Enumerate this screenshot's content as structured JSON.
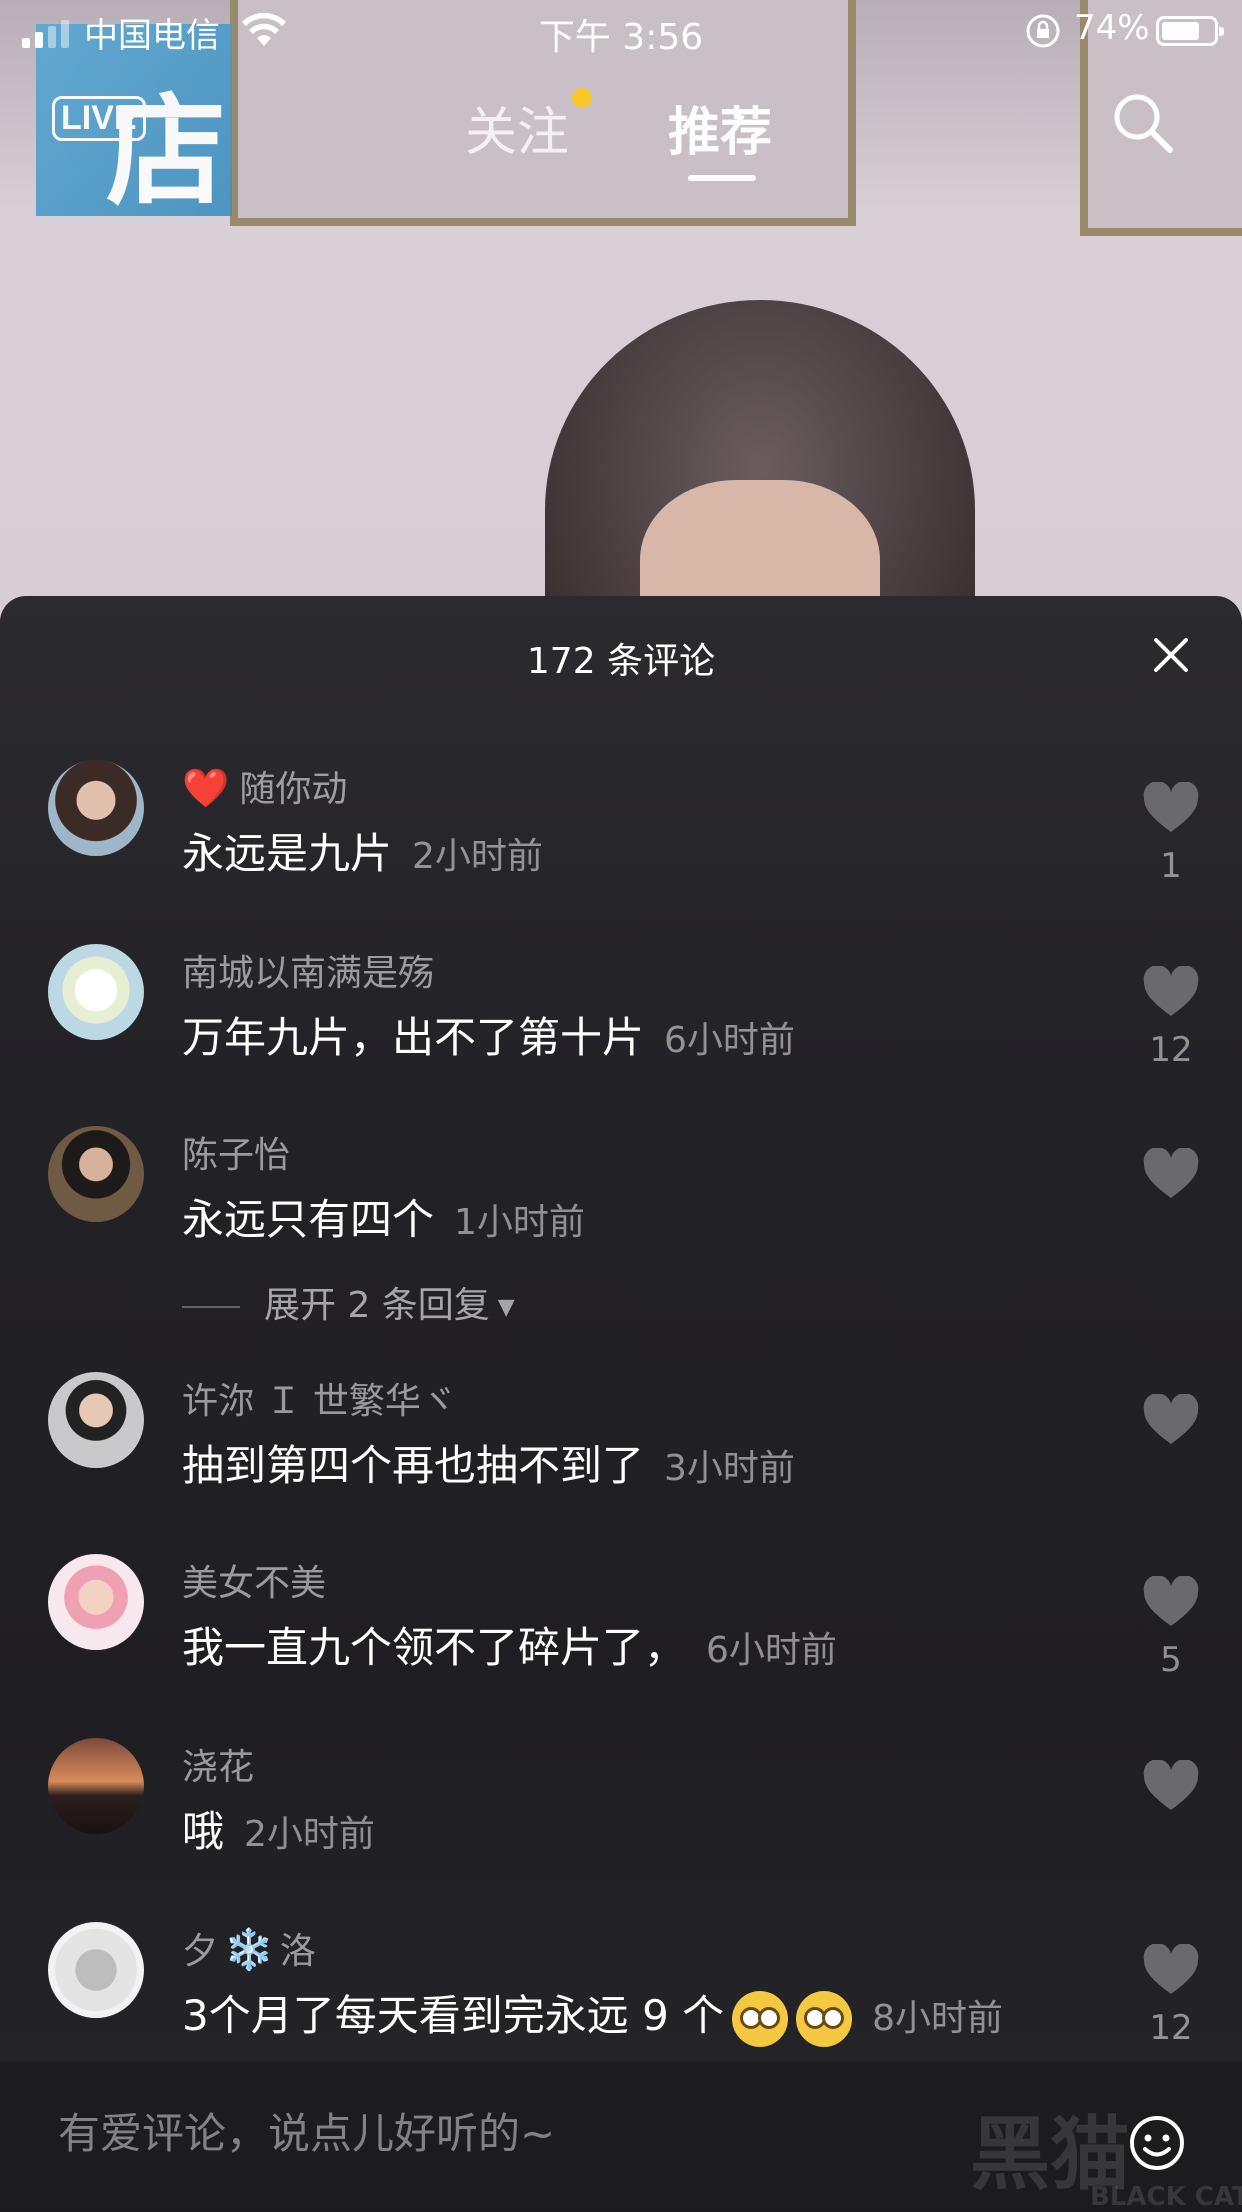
{
  "status_bar": {
    "carrier": "中国电信",
    "time": "下午 3:56",
    "battery_pct": "74%",
    "battery_level": 0.74
  },
  "live_badge": {
    "label": "LIVE",
    "char": "店"
  },
  "nav": {
    "tabs": [
      {
        "label": "关注",
        "has_dot": true
      },
      {
        "label": "推荐",
        "active": true
      }
    ],
    "dot_color": "#f7c72a"
  },
  "comments_sheet": {
    "title": "172 条评论",
    "comments": [
      {
        "username": "随你动",
        "prefix_emoji": "❤️",
        "text": "永远是九片",
        "time": "2小时前",
        "likes": "1"
      },
      {
        "username": "南城以南满是殇",
        "text": "万年九片，出不了第十片",
        "time": "6小时前",
        "likes": "12"
      },
      {
        "username": "陈子怡",
        "text": "永远只有四个",
        "time": "1小时前",
        "likes": ""
      },
      {
        "username": "许沵 Ｉ 世繁华ヾ",
        "text": "抽到第四个再也抽不到了",
        "time": "3小时前",
        "likes": ""
      },
      {
        "username": "美女不美",
        "text": "我一直九个领不了碎片了，",
        "time": "6小时前",
        "likes": "5"
      },
      {
        "username": "浇花",
        "text": "哦",
        "time": "2小时前",
        "likes": ""
      },
      {
        "username_a": "夕",
        "username_snow": "❄️",
        "username_b": "洛",
        "text": "3个月了每天看到完永远 9 个",
        "time": "8小时前",
        "likes": "12"
      }
    ],
    "expand_replies": "展开 2 条回复"
  },
  "input": {
    "placeholder": "有爱评论，说点儿好听的~"
  },
  "watermark": {
    "main": "黑猫",
    "sub": "BLACK CAT"
  }
}
